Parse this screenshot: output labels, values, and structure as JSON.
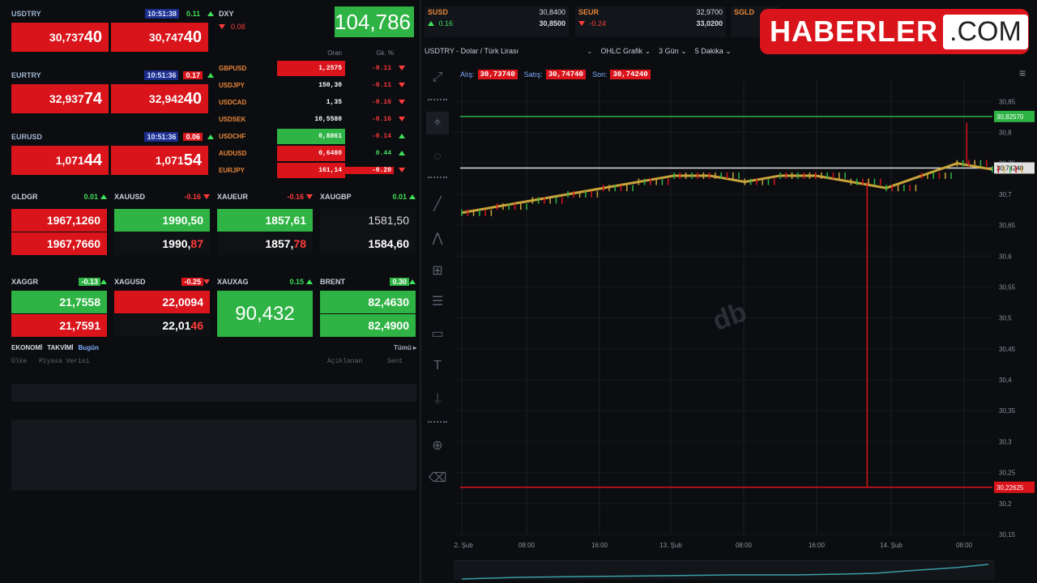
{
  "currencies": [
    {
      "symbol": "USDTRY",
      "time": "10:51:38",
      "change": "0.11",
      "bid": "30,737",
      "bid_big": "40",
      "ask": "30,747",
      "ask_big": "40"
    },
    {
      "symbol": "EURTRY",
      "time": "10:51:36",
      "change": "0.17",
      "bid": "32,937",
      "bid_big": "74",
      "ask": "32,942",
      "ask_big": "40"
    },
    {
      "symbol": "EURUSD",
      "time": "10:51:36",
      "change": "0.06",
      "bid": "1,071",
      "bid_big": "44",
      "ask": "1,071",
      "ask_big": "54"
    }
  ],
  "dxy": {
    "symbol": "DXY",
    "change": "0.08",
    "value": "104,786"
  },
  "fx_table": {
    "headers": [
      "Oran",
      "Gk. %"
    ],
    "rows": [
      {
        "pair": "GBPUSD",
        "rate": "1,2575",
        "pct": "-0.11",
        "dir": "dn",
        "bg": "red"
      },
      {
        "pair": "USDJPY",
        "rate": "150,30",
        "pct": "-0.11",
        "dir": "dn",
        "bg": ""
      },
      {
        "pair": "USDCAD",
        "rate": "1,35",
        "pct": "-0.16",
        "dir": "dn",
        "bg": ""
      },
      {
        "pair": "USDSEK",
        "rate": "10,5580",
        "pct": "-0.16",
        "dir": "dn",
        "bg": ""
      },
      {
        "pair": "USDCHF",
        "rate": "0,8861",
        "pct": "-0.14",
        "dir": "up",
        "bg": "green"
      },
      {
        "pair": "AUDUSD",
        "rate": "0,6480",
        "pct": "0.44",
        "dir": "up",
        "bg": "red"
      },
      {
        "pair": "EURJPY",
        "rate": "161,14",
        "pct": "-0.20",
        "dir": "dn",
        "bg": "red"
      }
    ]
  },
  "metals": [
    {
      "symbol": "GLDGR",
      "change": "0.01",
      "bid": "1967,1260",
      "ask": "1967,7660"
    },
    {
      "symbol": "XAUUSD",
      "change": "-0.16",
      "bid": "1990,50",
      "ask": "1990,",
      "ask_tail": "87"
    },
    {
      "symbol": "XAUEUR",
      "change": "-0.16",
      "bid": "1857,61",
      "ask": "1857,",
      "ask_tail": "78"
    },
    {
      "symbol": "XAUGBP",
      "change": "0.01",
      "bid": "1581,50",
      "ask": "1584,60"
    }
  ],
  "silver": [
    {
      "symbol": "XAGGR",
      "change": "-0.13",
      "bid": "21,7558",
      "ask": "21,7591"
    },
    {
      "symbol": "XAGUSD",
      "change": "-0.25",
      "bid": "22,0094",
      "ask": "22,01",
      "ask_tail": "46"
    },
    {
      "symbol": "XAUXAG",
      "change": "0.15",
      "value": "90,432"
    },
    {
      "symbol": "BRENT",
      "change": "0.30",
      "bid": "82,4630",
      "ask": "82,4900"
    }
  ],
  "news": {
    "tabs": [
      "EKONOMİ",
      "TAKVİMİ",
      "Bugün"
    ],
    "all_label": "Tümü ▸",
    "columns": [
      "Ülke",
      "Piyasa Verisi",
      "Açıklanan",
      "Sent"
    ]
  },
  "top_right": {
    "susd": {
      "symbol": "SUSD",
      "change": "0.16",
      "bid": "30,8400",
      "ask": "30,8500"
    },
    "seur": {
      "symbol": "SEUR",
      "change": "-0.24",
      "bid": "32,9700",
      "ask": "33,0200"
    },
    "sgld": {
      "symbol": "SGLD"
    }
  },
  "logo": {
    "main": "HABERLER",
    "suffix": ".COM"
  },
  "chart_toolbar": {
    "symbol": "USDTRY - Dolar / Türk Lirası",
    "type": "OHLC Grafik",
    "range": "3 Gün",
    "interval": "5 Dakika"
  },
  "chart_info": {
    "bid_label": "Alış:",
    "bid": "30,73740",
    "ask_label": "Satış:",
    "ask": "30,74740",
    "last_label": "Son:",
    "last": "30,74240"
  },
  "chart_data": {
    "type": "line",
    "title": "USDTRY - Dolar / Türk Lirası",
    "y_ticks": [
      "30,85",
      "30,8",
      "30,75",
      "30,7",
      "30,65",
      "30,6",
      "30,55",
      "30,5",
      "30,45",
      "30,4",
      "30,35",
      "30,3",
      "30,25",
      "30,2",
      "30,15"
    ],
    "x_ticks": [
      "12. Şub",
      "08:00",
      "16:00",
      "13. Şub",
      "08:00",
      "16:00",
      "14. Şub",
      "08:00"
    ],
    "ylim": [
      30.15,
      30.87
    ],
    "series": [
      {
        "values": [
          30.67,
          30.68,
          30.69,
          30.7,
          30.71,
          30.72,
          30.73,
          30.73,
          30.72,
          30.73,
          30.73,
          30.72,
          30.71,
          30.73,
          30.75,
          30.74
        ]
      }
    ],
    "levels": [
      {
        "label": "30,82570",
        "value": 30.8257,
        "color": "#2fb344"
      },
      {
        "label": "30,74240",
        "value": 30.7424,
        "color": "#e0e0e0"
      },
      {
        "label": "30,22625",
        "value": 30.22625,
        "color": "#d9141b"
      }
    ]
  },
  "colors": {
    "up": "#2fb344",
    "down": "#d9141b",
    "bg": "#0b0d10"
  }
}
